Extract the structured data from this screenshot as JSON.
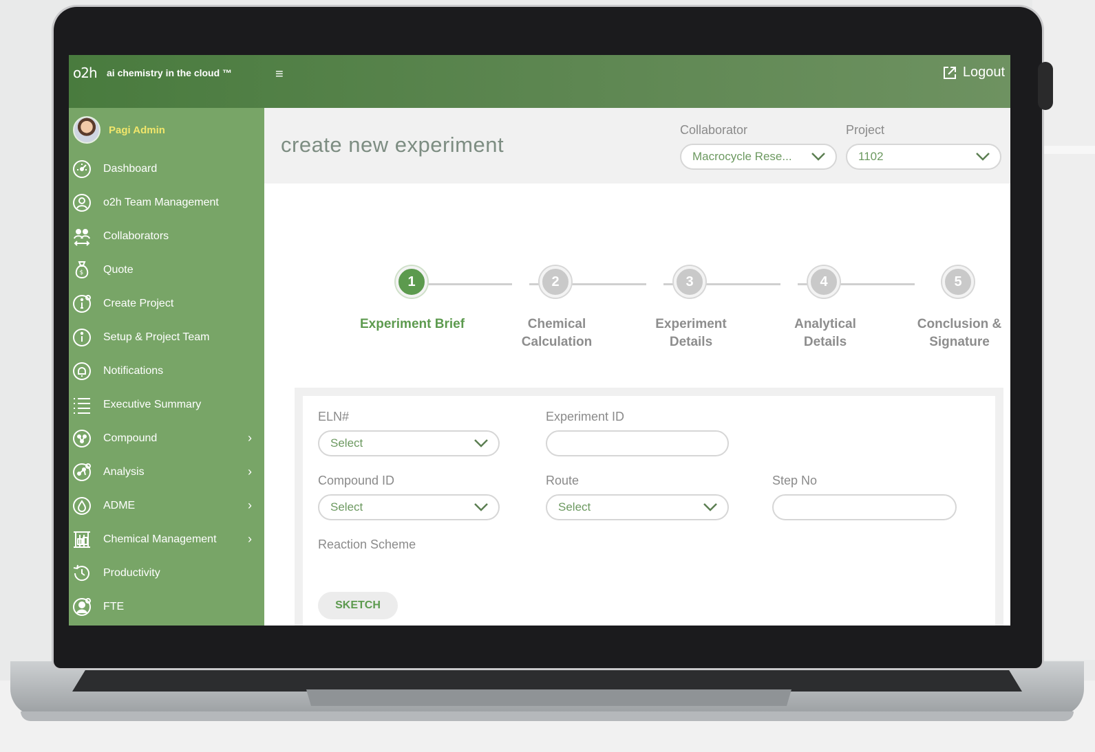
{
  "topbar": {
    "brand": "o2h",
    "tagline": "ai chemistry in the cloud ™",
    "menu_icon": "≡",
    "logout_label": "Logout"
  },
  "sidebar": {
    "user_name": "Pagi Admin",
    "items": [
      {
        "label": "Dashboard",
        "icon": "dashboard-icon"
      },
      {
        "label": "o2h Team Management",
        "icon": "team-icon"
      },
      {
        "label": "Collaborators",
        "icon": "collaborators-icon"
      },
      {
        "label": "Quote",
        "icon": "money-bag-icon"
      },
      {
        "label": "Create Project",
        "icon": "info-icon"
      },
      {
        "label": "Setup & Project Team",
        "icon": "info-icon"
      },
      {
        "label": "Notifications",
        "icon": "bell-icon"
      },
      {
        "label": "Executive Summary",
        "icon": "list-icon"
      },
      {
        "label": "Compound",
        "icon": "compound-icon",
        "chevron": "›"
      },
      {
        "label": "Analysis",
        "icon": "analysis-icon",
        "chevron": "›"
      },
      {
        "label": "ADME",
        "icon": "drop-icon",
        "chevron": "›"
      },
      {
        "label": "Chemical Management",
        "icon": "lab-icon",
        "chevron": "›"
      },
      {
        "label": "Productivity",
        "icon": "history-icon"
      },
      {
        "label": "FTE",
        "icon": "person-icon"
      }
    ]
  },
  "header": {
    "title": "create new experiment",
    "collaborator_label": "Collaborator",
    "collaborator_value": "Macrocycle Rese...",
    "project_label": "Project",
    "project_value": "1102"
  },
  "steps": [
    {
      "number": "1",
      "line1": "Experiment Brief",
      "line2": ""
    },
    {
      "number": "2",
      "line1": "Chemical",
      "line2": "Calculation"
    },
    {
      "number": "3",
      "line1": "Experiment",
      "line2": "Details"
    },
    {
      "number": "4",
      "line1": "Analytical",
      "line2": "Details"
    },
    {
      "number": "5",
      "line1": "Conclusion &",
      "line2": "Signature"
    }
  ],
  "active_step": 1,
  "form": {
    "eln_label": "ELN#",
    "eln_value": "Select",
    "experiment_id_label": "Experiment ID",
    "experiment_id_value": "",
    "compound_id_label": "Compound ID",
    "compound_id_value": "Select",
    "route_label": "Route",
    "route_value": "Select",
    "step_no_label": "Step No",
    "step_no_value": "",
    "reaction_scheme_label": "Reaction Scheme",
    "sketch_label": "SKETCH"
  },
  "colors": {
    "topbar": "#5e8752",
    "sidebar": "#78a567",
    "accent": "#5c9a4e",
    "user_name": "#f1e66b"
  }
}
